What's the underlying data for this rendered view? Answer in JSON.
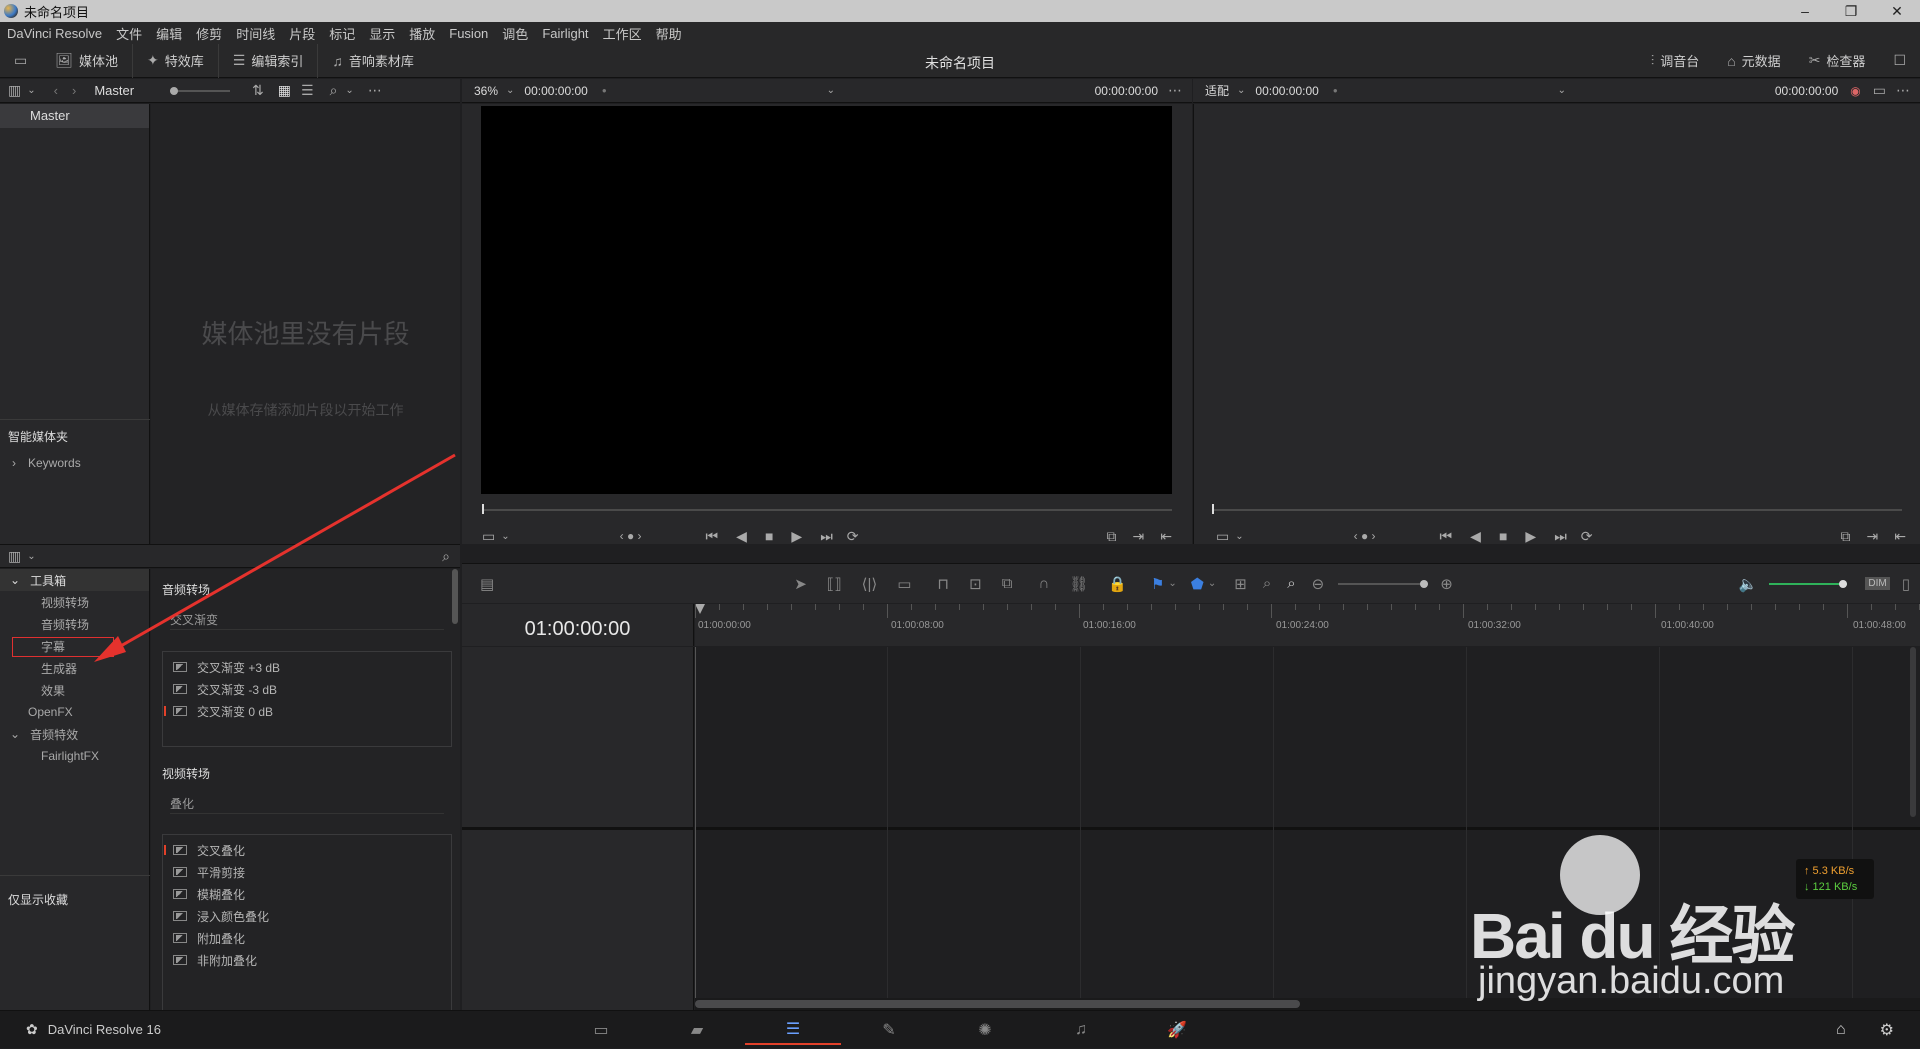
{
  "window": {
    "title": "未命名项目"
  },
  "menu": [
    "DaVinci Resolve",
    "文件",
    "编辑",
    "修剪",
    "时间线",
    "片段",
    "标记",
    "显示",
    "播放",
    "Fusion",
    "调色",
    "Fairlight",
    "工作区",
    "帮助"
  ],
  "toolbar": {
    "media_pool": "媒体池",
    "effects_library": "特效库",
    "edit_index": "编辑索引",
    "sound_library": "音响素材库",
    "project_title": "未命名项目",
    "mixer": "调音台",
    "metadata": "元数据",
    "inspector": "检查器"
  },
  "media_pool": {
    "bin_label": "Master",
    "master_item": "Master",
    "empty_title": "媒体池里没有片段",
    "empty_hint": "从媒体存储添加片段以开始工作",
    "smart_bins": "智能媒体夹",
    "keywords": "Keywords"
  },
  "source_viewer": {
    "zoom": "36%",
    "timecode_left": "00:00:00:00",
    "timecode_right": "00:00:00:00"
  },
  "timeline_viewer": {
    "fit": "适配",
    "timecode_left": "00:00:00:00",
    "timecode_right": "00:00:00:00"
  },
  "effects": {
    "toolbox": "工具箱",
    "video_transitions": "视频转场",
    "audio_transitions": "音频转场",
    "titles": "字幕",
    "generators": "生成器",
    "effects": "效果",
    "openfx": "OpenFX",
    "audio_fx": "音频特效",
    "fairlight_fx": "FairlightFX",
    "favorites_only": "仅显示收藏",
    "audio_section": "音频转场",
    "crossfade_group": "交叉渐变",
    "audio_items": [
      "交叉渐变 +3 dB",
      "交叉渐变 -3 dB",
      "交叉渐变 0 dB"
    ],
    "video_section": "视频转场",
    "dissolve_group": "叠化",
    "video_items": [
      "交叉叠化",
      "平滑剪接",
      "模糊叠化",
      "浸入颜色叠化",
      "附加叠化",
      "非附加叠化"
    ]
  },
  "timeline": {
    "timecode": "01:00:00:00",
    "ruler": [
      "01:00:00:00",
      "01:00:08:00",
      "01:00:16:00",
      "01:00:24:00",
      "01:00:32:00",
      "01:00:40:00",
      "01:00:48:00"
    ],
    "dim": "DIM"
  },
  "network": {
    "up": "↑ 5.3 KB/s",
    "down": "↓ 121 KB/s"
  },
  "footer": {
    "app_name": "DaVinci Resolve 16"
  },
  "watermark": {
    "brand": "Bai du 经验",
    "url": "jingyan.baidu.com"
  }
}
